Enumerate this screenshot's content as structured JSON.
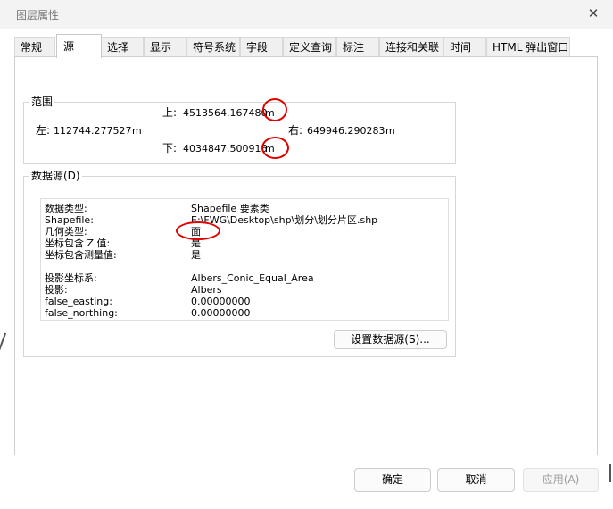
{
  "window": {
    "title": "图层属性"
  },
  "tabs": [
    {
      "label": "常规"
    },
    {
      "label": "源"
    },
    {
      "label": "选择"
    },
    {
      "label": "显示"
    },
    {
      "label": "符号系统"
    },
    {
      "label": "字段"
    },
    {
      "label": "定义查询"
    },
    {
      "label": "标注"
    },
    {
      "label": "连接和关联"
    },
    {
      "label": "时间"
    },
    {
      "label": "HTML 弹出窗口"
    }
  ],
  "extent": {
    "label": "范围",
    "top_label": "上:",
    "top_value": "4513564.167480",
    "top_unit": "m",
    "left_label": "左:",
    "left_value": "112744.277527",
    "left_unit": "m",
    "right_label": "右:",
    "right_value": "649946.290283",
    "right_unit": "m",
    "bottom_label": "下:",
    "bottom_value": "4034847.500916",
    "bottom_unit": "m"
  },
  "datasource": {
    "label": "数据源(D)",
    "rows": [
      {
        "key": "数据类型:",
        "value": "Shapefile 要素类"
      },
      {
        "key": "Shapefile:",
        "value": "E:\\FWG\\Desktop\\shp\\划分\\划分片区.shp"
      },
      {
        "key": "几何类型:",
        "value": "面"
      },
      {
        "key": "坐标包含 Z 值:",
        "value": "是"
      },
      {
        "key": "坐标包含测量值:",
        "value": "是"
      },
      {
        "key": "投影坐标系:",
        "value": "Albers_Conic_Equal_Area"
      },
      {
        "key": "投影:",
        "value": "Albers"
      },
      {
        "key": "false_easting:",
        "value": "0.00000000"
      },
      {
        "key": "false_northing:",
        "value": "0.00000000"
      }
    ],
    "set_button": "设置数据源(S)..."
  },
  "footer": {
    "ok": "确定",
    "cancel": "取消",
    "apply": "应用(A)"
  }
}
